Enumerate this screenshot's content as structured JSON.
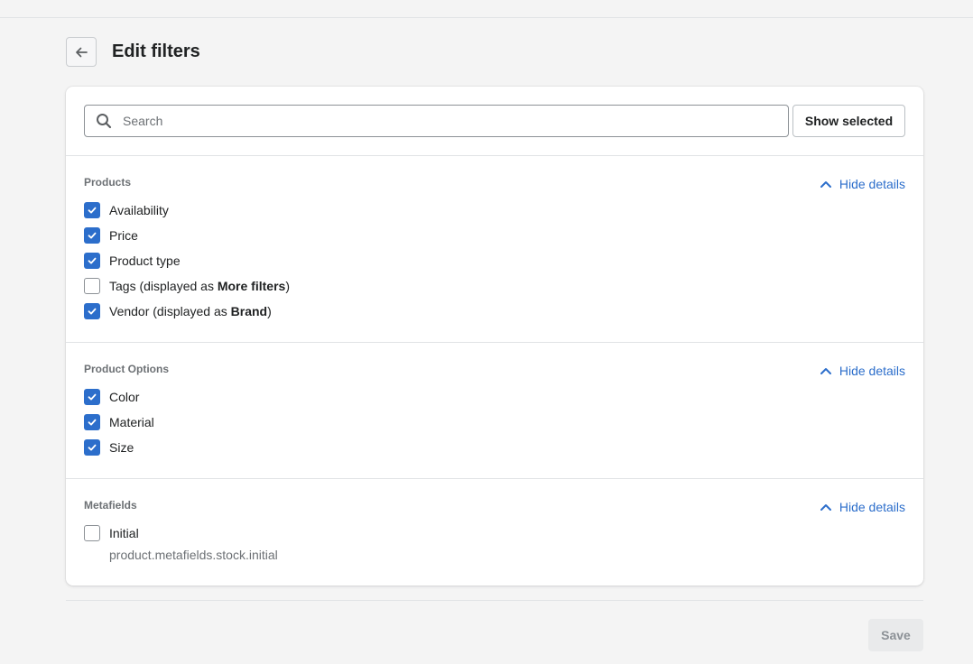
{
  "header": {
    "title": "Edit filters",
    "back_icon": "arrow-left-icon"
  },
  "search": {
    "placeholder": "Search",
    "value": "",
    "show_selected_label": "Show selected"
  },
  "sections": [
    {
      "title": "Products",
      "toggle_label": "Hide details",
      "items": [
        {
          "label": "Availability",
          "checked": true
        },
        {
          "label": "Price",
          "checked": true
        },
        {
          "label": "Product type",
          "checked": true
        },
        {
          "label_prefix": "Tags (displayed as ",
          "label_bold": "More filters",
          "label_suffix": ")",
          "checked": false
        },
        {
          "label_prefix": "Vendor (displayed as ",
          "label_bold": "Brand",
          "label_suffix": ")",
          "checked": true
        }
      ]
    },
    {
      "title": "Product Options",
      "toggle_label": "Hide details",
      "items": [
        {
          "label": "Color",
          "checked": true
        },
        {
          "label": "Material",
          "checked": true
        },
        {
          "label": "Size",
          "checked": true
        }
      ]
    },
    {
      "title": "Metafields",
      "toggle_label": "Hide details",
      "items": [
        {
          "label": "Initial",
          "checked": false,
          "sublabel": "product.metafields.stock.initial"
        }
      ]
    }
  ],
  "footer": {
    "save_label": "Save"
  },
  "colors": {
    "accent": "#2c6ecb",
    "background": "#f4f4f4"
  }
}
